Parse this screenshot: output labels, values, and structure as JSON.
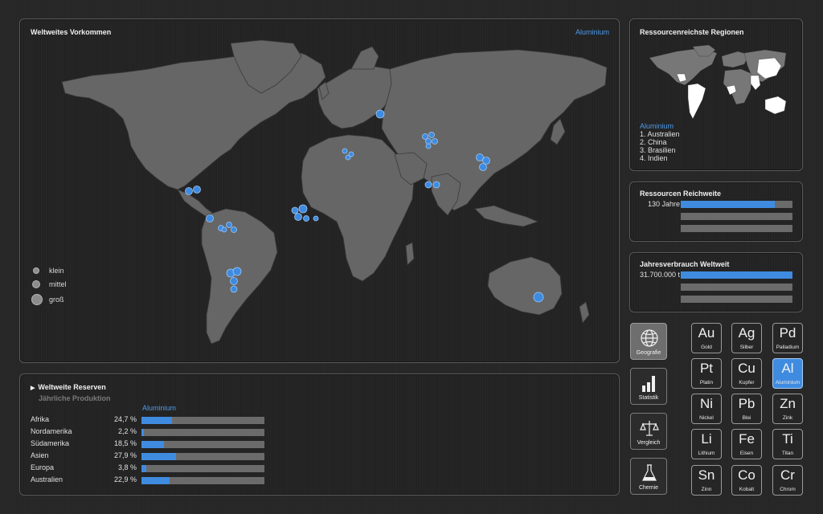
{
  "colors": {
    "accent": "#3f8be0",
    "land": "#666666",
    "highlight": "#ffffff",
    "background": "#262626"
  },
  "map": {
    "title": "Weltweites Vorkommen",
    "material": "Aluminium",
    "legend": [
      {
        "label": "klein",
        "size": "small"
      },
      {
        "label": "mittel",
        "size": "medium"
      },
      {
        "label": "groß",
        "size": "large"
      }
    ]
  },
  "regions": {
    "title": "Ressourcenreichste Regionen",
    "material": "Aluminium",
    "items": [
      "1. Australien",
      "2. China",
      "3. Brasilien",
      "4. Indien"
    ]
  },
  "range": {
    "title": "Ressourcen Reichweite",
    "label": "130 Jahre",
    "fill_fraction": 0.84
  },
  "consumption": {
    "title": "Jahresverbrauch Weltweit",
    "label": "31.700.000 t",
    "fill_fraction": 1.0
  },
  "reserves": {
    "title": "Weltweite Reserven",
    "subtitle": "Jährliche Produktion",
    "material": "Aluminium",
    "rows": [
      {
        "name": "Afrika",
        "value": "24,7 %",
        "pct": 24.7
      },
      {
        "name": "Nordamerika",
        "value": "2,2 %",
        "pct": 2.2
      },
      {
        "name": "Südamerika",
        "value": "18,5 %",
        "pct": 18.5
      },
      {
        "name": "Asien",
        "value": "27,9 %",
        "pct": 27.9
      },
      {
        "name": "Europa",
        "value": "3,8 %",
        "pct": 3.8
      },
      {
        "name": "Australien",
        "value": "22,9 %",
        "pct": 22.9
      }
    ]
  },
  "nav": [
    {
      "label": "Geografie",
      "icon": "globe-icon",
      "active": true
    },
    {
      "label": "Statistik",
      "icon": "bar-chart-icon",
      "active": false
    },
    {
      "label": "Vergleich",
      "icon": "scale-icon",
      "active": false
    },
    {
      "label": "Chemie",
      "icon": "flask-icon",
      "active": false
    }
  ],
  "elements": [
    {
      "symbol": "Au",
      "name": "Gold",
      "active": false
    },
    {
      "symbol": "Ag",
      "name": "Silber",
      "active": false
    },
    {
      "symbol": "Pd",
      "name": "Palladium",
      "active": false
    },
    {
      "symbol": "Pt",
      "name": "Platin",
      "active": false
    },
    {
      "symbol": "Cu",
      "name": "Kupfer",
      "active": false
    },
    {
      "symbol": "Al",
      "name": "Aluminium",
      "active": true
    },
    {
      "symbol": "Ni",
      "name": "Nickel",
      "active": false
    },
    {
      "symbol": "Pb",
      "name": "Blei",
      "active": false
    },
    {
      "symbol": "Zn",
      "name": "Zink",
      "active": false
    },
    {
      "symbol": "Li",
      "name": "Lithium",
      "active": false
    },
    {
      "symbol": "Fe",
      "name": "Eisen",
      "active": false
    },
    {
      "symbol": "Ti",
      "name": "Titan",
      "active": false
    },
    {
      "symbol": "Sn",
      "name": "Zinn",
      "active": false
    },
    {
      "symbol": "Co",
      "name": "Kobalt",
      "active": false
    },
    {
      "symbol": "Cr",
      "name": "Chrom",
      "active": false
    }
  ]
}
